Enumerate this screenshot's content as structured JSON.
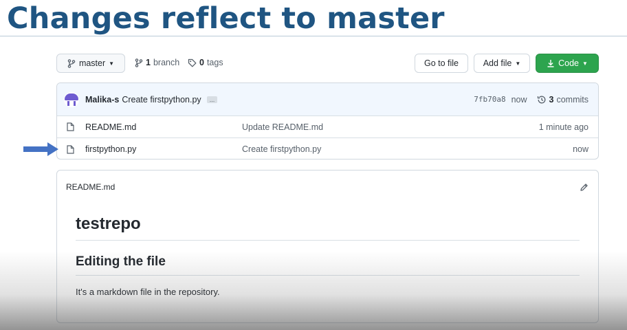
{
  "slide": {
    "title": "Changes reflect to master"
  },
  "toolbar": {
    "branch_label": "master",
    "branches_count": "1",
    "branches_label": "branch",
    "tags_count": "0",
    "tags_label": "tags",
    "goto_file_label": "Go to file",
    "add_file_label": "Add file",
    "code_label": "Code"
  },
  "latest_commit": {
    "author": "Malika-s",
    "message": "Create firstpython.py",
    "ellipsis": "...",
    "sha": "7fb70a8",
    "time": "now",
    "commits_count": "3",
    "commits_label": "commits"
  },
  "files": [
    {
      "name": "README.md",
      "commit": "Update README.md",
      "time": "1 minute ago"
    },
    {
      "name": "firstpython.py",
      "commit": "Create firstpython.py",
      "time": "now"
    }
  ],
  "readme": {
    "filename": "README.md",
    "h1": "testrepo",
    "h2": "Editing the file",
    "paragraph": "It's a markdown file in the repository."
  },
  "colors": {
    "title": "#1f5582",
    "code_button": "#2da44e",
    "arrow": "#4472c4",
    "avatar": "#6d5bd0"
  },
  "icons": [
    "branch-icon",
    "tag-icon",
    "download-icon",
    "history-icon",
    "file-icon",
    "pencil-icon",
    "arrow-icon"
  ]
}
